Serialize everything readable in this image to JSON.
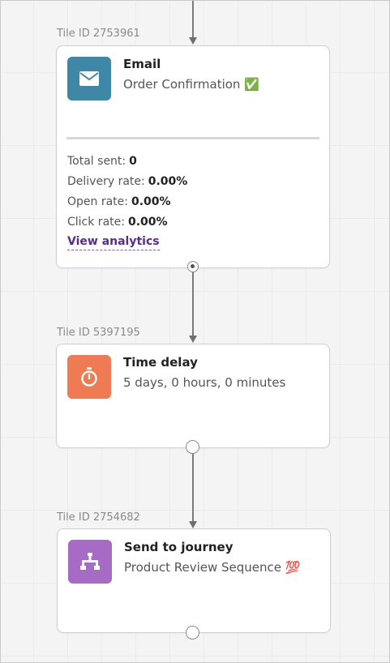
{
  "tiles": [
    {
      "tile_id": "Tile ID 2753961",
      "icon": "envelope-icon",
      "icon_color": "#3f87a6",
      "title": "Email",
      "subtitle": "Order Confirmation ✅",
      "stats": {
        "total_sent_label": "Total sent:",
        "total_sent_value": "0",
        "delivery_rate_label": "Delivery rate:",
        "delivery_rate_value": "0.00%",
        "open_rate_label": "Open rate:",
        "open_rate_value": "0.00%",
        "click_rate_label": "Click rate:",
        "click_rate_value": "0.00%"
      },
      "link_label": "View analytics"
    },
    {
      "tile_id": "Tile ID 5397195",
      "icon": "stopwatch-icon",
      "icon_color": "#ee7b53",
      "title": "Time delay",
      "subtitle": "5 days, 0 hours, 0 minutes"
    },
    {
      "tile_id": "Tile ID 2754682",
      "icon": "journey-split-icon",
      "icon_color": "#a56bc5",
      "title": "Send to journey",
      "subtitle": "Product Review Sequence 💯"
    }
  ]
}
